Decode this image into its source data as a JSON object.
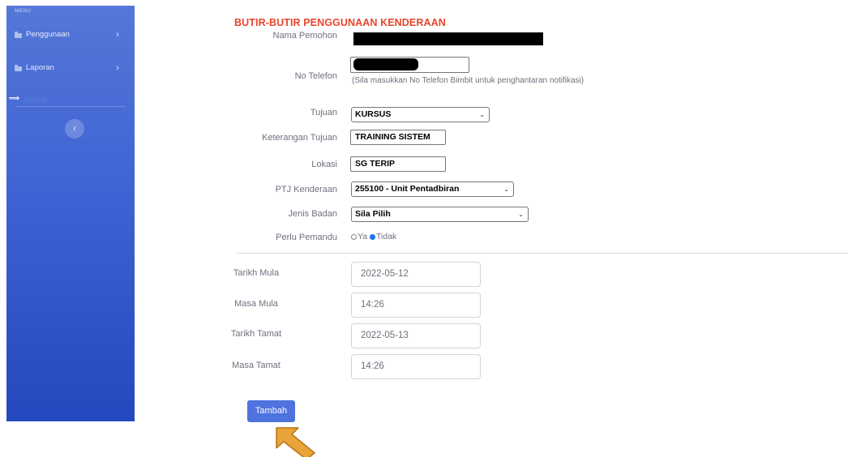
{
  "sidebar": {
    "heading": "MENU",
    "items": [
      {
        "label": "Penggunaan",
        "icon": "folder-icon",
        "chevron": "›"
      },
      {
        "label": "Laporan",
        "icon": "folder-icon",
        "chevron": "›"
      }
    ],
    "logout_label": "Logout",
    "logout_icon": "⟹",
    "toggle_glyph": "‹"
  },
  "form": {
    "title": "BUTIR-BUTIR PENGGUNAAN KENDERAAN",
    "fields": {
      "nama_pemohon": {
        "label": "Nama Pemohon"
      },
      "no_telefon": {
        "label": "No Telefon",
        "helper": "(Sila masukkan No Telefon Bimbit untuk penghantaran notifikasi)"
      },
      "tujuan": {
        "label": "Tujuan",
        "value": "KURSUS"
      },
      "keterangan_tujuan": {
        "label": "Keterangan Tujuan",
        "value": "TRAINING SISTEM"
      },
      "lokasi": {
        "label": "Lokasi",
        "value": "SG TERIP"
      },
      "ptj_kenderaan": {
        "label": "PTJ Kenderaan",
        "value": "255100 - Unit Pentadbiran"
      },
      "jenis_badan": {
        "label": "Jenis Badan",
        "value": "Sila Pilih"
      },
      "perlu_pemandu": {
        "label": "Perlu Pemandu",
        "options": [
          "Ya",
          "Tidak"
        ],
        "selected": "Tidak"
      },
      "tarikh_mula": {
        "label": "Tarikh Mula",
        "value": "2022-05-12"
      },
      "masa_mula": {
        "label": "Masa Mula",
        "value": "14:26"
      },
      "tarikh_tamat": {
        "label": "Tarikh Tamat",
        "value": "2022-05-13"
      },
      "masa_tamat": {
        "label": "Masa Tamat",
        "value": "14:26"
      }
    },
    "submit_label": "Tambah"
  },
  "colors": {
    "sidebar_top": "#5577d8",
    "sidebar_bottom": "#2448bd",
    "title": "#e8452c",
    "primary": "#4e73df",
    "pointer": "#e8a33a"
  }
}
